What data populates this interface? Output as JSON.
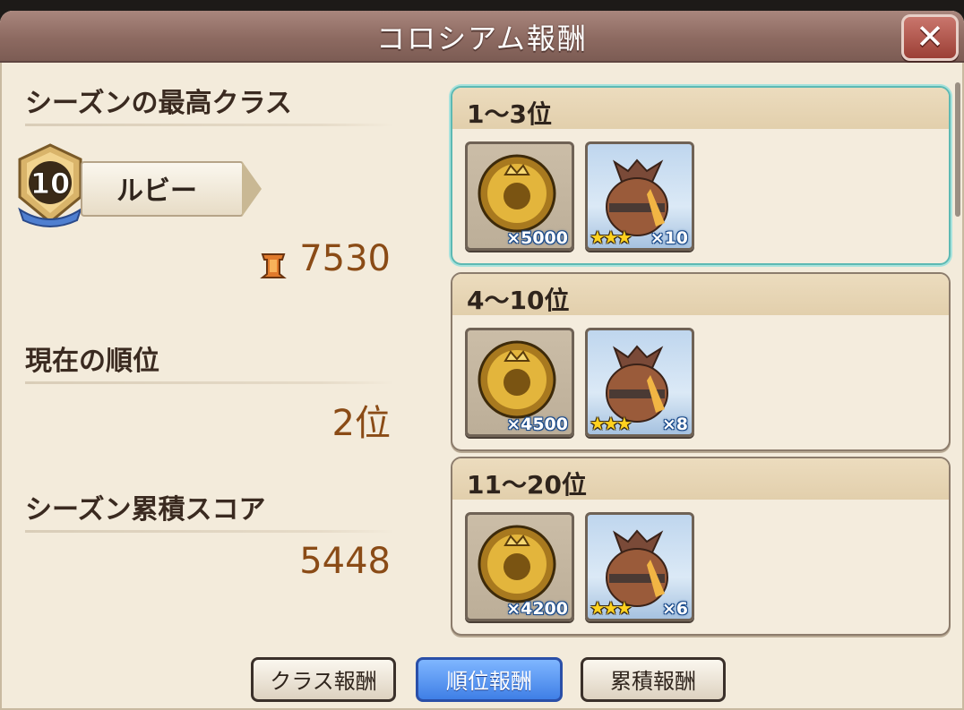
{
  "dialog": {
    "title": "コロシアム報酬",
    "close_label": "✕"
  },
  "left": {
    "best_class_label": "シーズンの最高クラス",
    "class_level": "10",
    "class_name": "ルビー",
    "trophy_count": "7530",
    "current_rank_label": "現在の順位",
    "current_rank": "2位",
    "score_label": "シーズン累積スコア",
    "score": "5448"
  },
  "rewards": [
    {
      "rank_range": "1〜3位",
      "medal_count": "×5000",
      "bag_stars": "★★★",
      "bag_count": "×10",
      "selected": true
    },
    {
      "rank_range": "4〜10位",
      "medal_count": "×4500",
      "bag_stars": "★★★",
      "bag_count": "×8",
      "selected": false
    },
    {
      "rank_range": "11〜20位",
      "medal_count": "×4200",
      "bag_stars": "★★★",
      "bag_count": "×6",
      "selected": false
    }
  ],
  "tabs": [
    {
      "label": "クラス報酬",
      "active": false
    },
    {
      "label": "順位報酬",
      "active": true
    },
    {
      "label": "累積報酬",
      "active": false
    }
  ],
  "colors": {
    "title_bar": "#8d6a61",
    "panel": "#f3ebdb",
    "value_text": "#8a4b16",
    "active_tab": "#3f7fe6",
    "selected_card_border": "#5db9b3"
  },
  "icons": [
    "close-icon",
    "class-rank-badge-icon",
    "trophy-icon",
    "colosseum-medal-icon",
    "reward-bag-icon",
    "star-icon"
  ]
}
